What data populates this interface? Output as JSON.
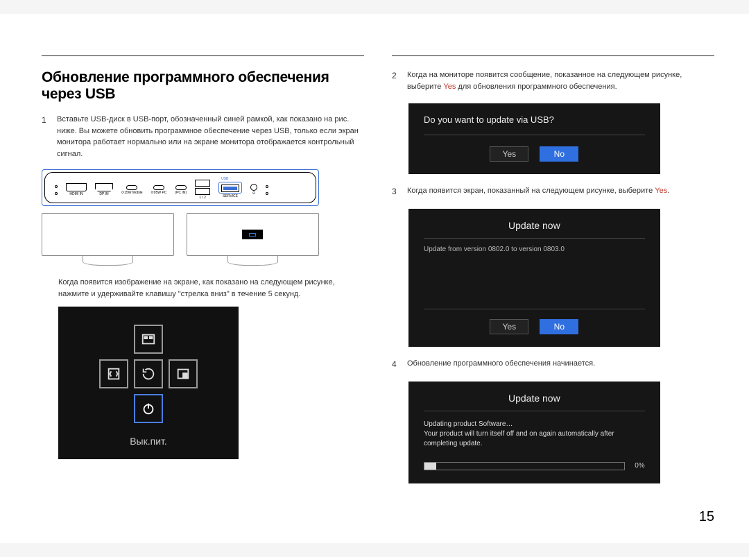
{
  "title": "Обновление программного обеспечения через USB",
  "page_number": "15",
  "left": {
    "step1_num": "1",
    "step1_text": "Вставьте USB-диск в USB-порт, обозначенный синей рамкой, как показано на рис. ниже. Вы можете обновить программное обеспечение через USB, только если экран монитора работает нормально или на экране монитора отображается контрольный сигнал.",
    "ports": {
      "hdmi": "HDMI IN",
      "dp": "DP IN",
      "usbc1": "⟳15W Mobile",
      "usbc2": "⟳95W PC",
      "usbc3": "(PC IN)",
      "usba12": "1 / 2",
      "service": "SERVICE",
      "audio": "Ω",
      "usb_tag": "USB"
    },
    "sub1": "Когда появится изображение на экране, как показано на следующем рисунке, нажмите и удерживайте клавишу \"стрелка вниз\" в течение 5 секунд.",
    "osd_caption": "Вык.пит."
  },
  "right": {
    "step2_num": "2",
    "step2_text_a": "Когда на мониторе появится сообщение, показанное на следующем рисунке, выберите ",
    "step2_yes": "Yes",
    "step2_text_b": " для обновления программного обеспечения.",
    "dlg1": {
      "q": "Do you want to update via USB?",
      "yes": "Yes",
      "no": "No"
    },
    "step3_num": "3",
    "step3_text_a": "Когда появится экран, показанный на следующем рисунке, выберите ",
    "step3_yes": "Yes",
    "step3_text_b": ".",
    "dlg2": {
      "title": "Update now",
      "body": "Update from version 0802.0 to version 0803.0",
      "yes": "Yes",
      "no": "No"
    },
    "step4_num": "4",
    "step4_text": "Обновление программного обеспечения начинается.",
    "dlg3": {
      "title": "Update now",
      "line1": "Updating product Software…",
      "line2": "Your product will turn itself off and on again automatically after completing update.",
      "pct": "0%"
    }
  }
}
